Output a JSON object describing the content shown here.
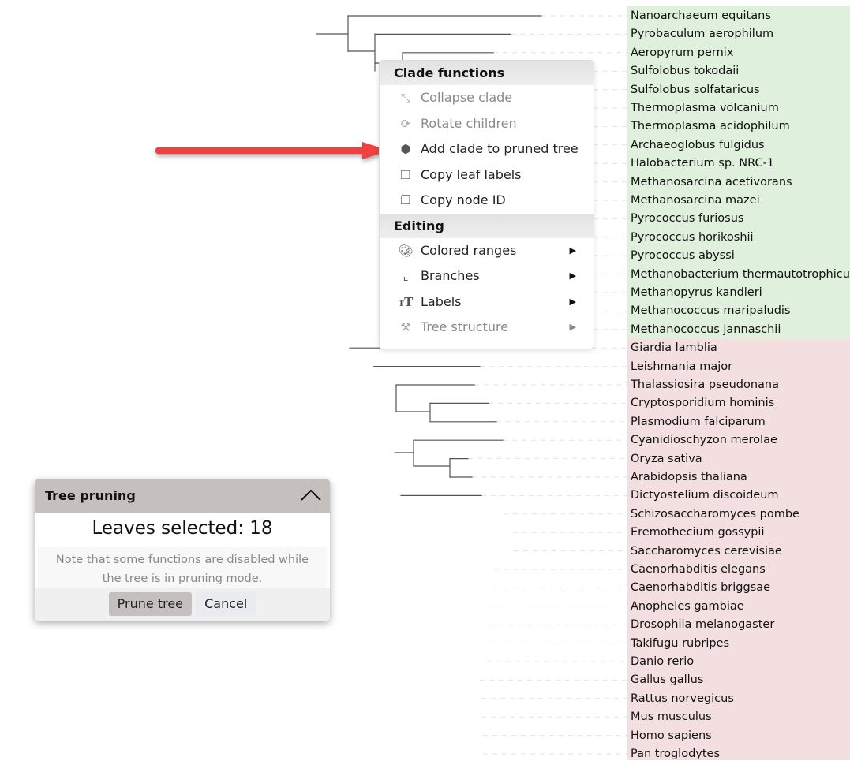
{
  "leaves": [
    {
      "label": "Nanoarchaeum equitans",
      "group": "archaea"
    },
    {
      "label": "Pyrobaculum aerophilum",
      "group": "archaea"
    },
    {
      "label": "Aeropyrum pernix",
      "group": "archaea"
    },
    {
      "label": "Sulfolobus tokodaii",
      "group": "archaea"
    },
    {
      "label": "Sulfolobus solfataricus",
      "group": "archaea"
    },
    {
      "label": "Thermoplasma volcanium",
      "group": "archaea"
    },
    {
      "label": "Thermoplasma acidophilum",
      "group": "archaea"
    },
    {
      "label": "Archaeoglobus fulgidus",
      "group": "archaea"
    },
    {
      "label": "Halobacterium sp. NRC-1",
      "group": "archaea"
    },
    {
      "label": "Methanosarcina acetivorans",
      "group": "archaea"
    },
    {
      "label": "Methanosarcina mazei",
      "group": "archaea"
    },
    {
      "label": "Pyrococcus furiosus",
      "group": "archaea"
    },
    {
      "label": "Pyrococcus horikoshii",
      "group": "archaea"
    },
    {
      "label": "Pyrococcus abyssi",
      "group": "archaea"
    },
    {
      "label": "Methanobacterium thermautotrophicum",
      "group": "archaea"
    },
    {
      "label": "Methanopyrus kandleri",
      "group": "archaea"
    },
    {
      "label": "Methanococcus maripaludis",
      "group": "archaea"
    },
    {
      "label": "Methanococcus jannaschii",
      "group": "archaea"
    },
    {
      "label": "Giardia lamblia",
      "group": "eukaryota"
    },
    {
      "label": "Leishmania major",
      "group": "eukaryota"
    },
    {
      "label": "Thalassiosira pseudonana",
      "group": "eukaryota"
    },
    {
      "label": "Cryptosporidium hominis",
      "group": "eukaryota"
    },
    {
      "label": "Plasmodium falciparum",
      "group": "eukaryota"
    },
    {
      "label": "Cyanidioschyzon merolae",
      "group": "eukaryota"
    },
    {
      "label": "Oryza sativa",
      "group": "eukaryota"
    },
    {
      "label": "Arabidopsis thaliana",
      "group": "eukaryota"
    },
    {
      "label": "Dictyostelium discoideum",
      "group": "eukaryota"
    },
    {
      "label": "Schizosaccharomyces pombe",
      "group": "eukaryota"
    },
    {
      "label": "Eremothecium gossypii",
      "group": "eukaryota"
    },
    {
      "label": "Saccharomyces cerevisiae",
      "group": "eukaryota"
    },
    {
      "label": "Caenorhabditis elegans",
      "group": "eukaryota"
    },
    {
      "label": "Caenorhabditis briggsae",
      "group": "eukaryota"
    },
    {
      "label": "Anopheles gambiae",
      "group": "eukaryota"
    },
    {
      "label": "Drosophila melanogaster",
      "group": "eukaryota"
    },
    {
      "label": "Takifugu rubripes",
      "group": "eukaryota"
    },
    {
      "label": "Danio rerio",
      "group": "eukaryota"
    },
    {
      "label": "Gallus gallus",
      "group": "eukaryota"
    },
    {
      "label": "Rattus norvegicus",
      "group": "eukaryota"
    },
    {
      "label": "Mus musculus",
      "group": "eukaryota"
    },
    {
      "label": "Homo sapiens",
      "group": "eukaryota"
    },
    {
      "label": "Pan troglodytes",
      "group": "eukaryota"
    }
  ],
  "colors": {
    "archaea_range": "#dff0dc",
    "eukaryota_range": "#f3dfe0",
    "selected_branch": "#22aa22",
    "branch": "#444444",
    "arrow": "#f04040"
  },
  "context_menu": {
    "sections": [
      {
        "title": "Clade functions",
        "items": [
          {
            "label": "Collapse clade",
            "icon": "collapse-icon",
            "disabled": true
          },
          {
            "label": "Rotate children",
            "icon": "rotate-icon",
            "disabled": true
          },
          {
            "label": "Add clade to pruned tree",
            "icon": "plus-hexagon-icon",
            "disabled": false
          },
          {
            "label": "Copy leaf labels",
            "icon": "copy-icon",
            "disabled": false
          },
          {
            "label": "Copy node ID",
            "icon": "copy-icon",
            "disabled": false
          }
        ]
      },
      {
        "title": "Editing",
        "items": [
          {
            "label": "Colored ranges",
            "icon": "palette-icon",
            "disabled": false,
            "submenu": true
          },
          {
            "label": "Branches",
            "icon": "branches-icon",
            "disabled": false,
            "submenu": true
          },
          {
            "label": "Labels",
            "icon": "text-size-icon",
            "disabled": false,
            "submenu": true
          },
          {
            "label": "Tree structure",
            "icon": "construction-icon",
            "disabled": true,
            "submenu": true
          }
        ]
      }
    ]
  },
  "pruning_panel": {
    "title": "Tree pruning",
    "count_text": "Leaves selected: 18",
    "note": "Note that some functions are disabled while the tree is in pruning mode.",
    "prune_label": "Prune tree",
    "cancel_label": "Cancel"
  }
}
